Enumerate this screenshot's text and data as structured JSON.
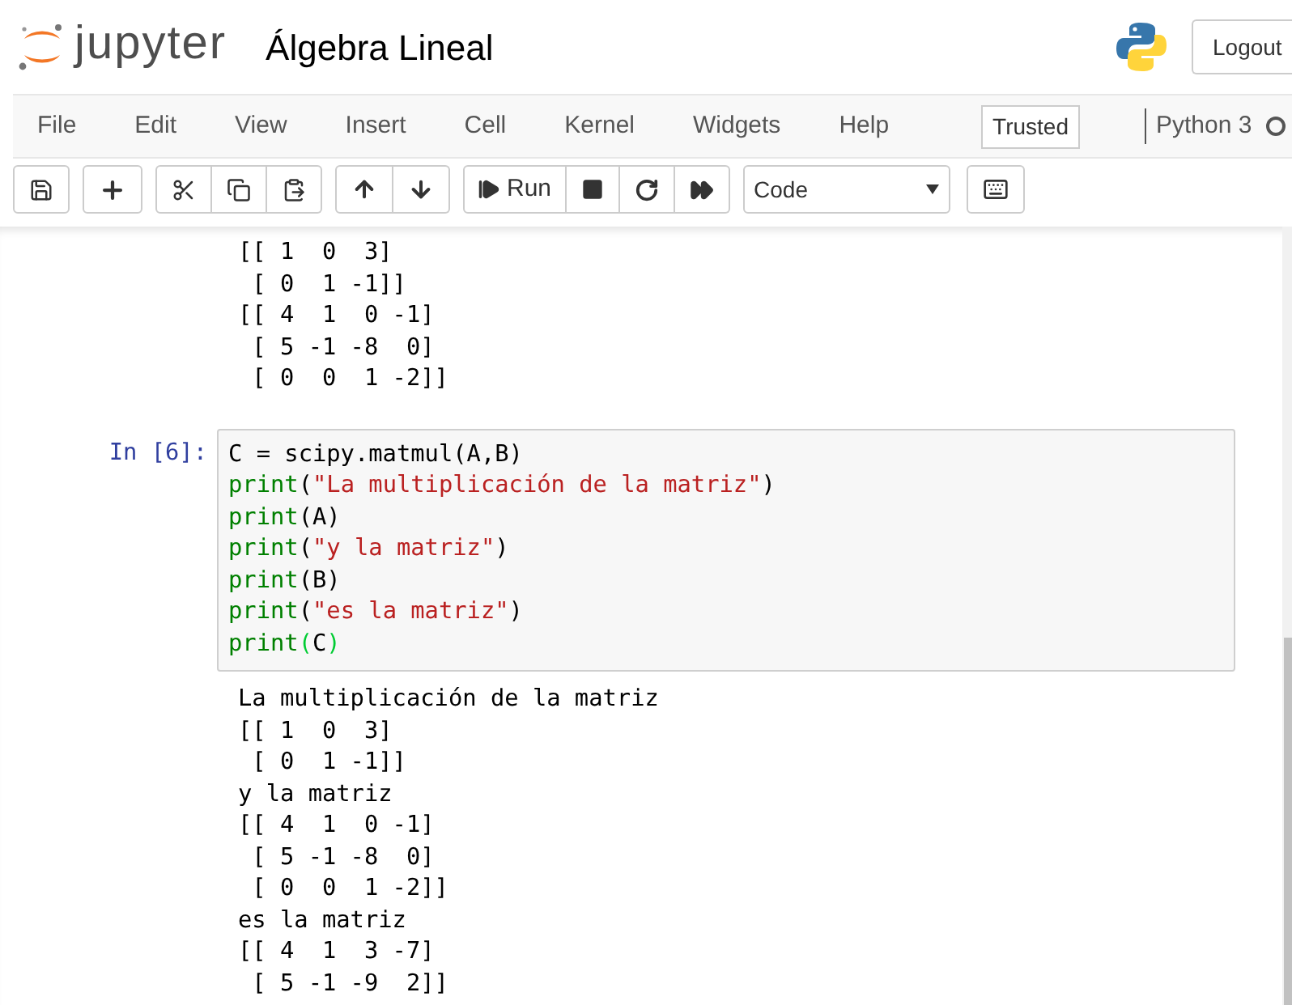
{
  "header": {
    "logo_text": "jupyter",
    "title": "Álgebra Lineal",
    "logout": "Logout"
  },
  "menu": [
    "File",
    "Edit",
    "View",
    "Insert",
    "Cell",
    "Kernel",
    "Widgets",
    "Help"
  ],
  "trusted": "Trusted",
  "kernel": "Python 3",
  "toolbar": {
    "run": "Run",
    "cell_type": "Code"
  },
  "cells": [
    {
      "kind": "output",
      "lines": [
        "[[ 1  0  3]",
        " [ 0  1 -1]]",
        "[[ 4  1  0 -1]",
        " [ 5 -1 -8  0]",
        " [ 0  0  1 -2]]"
      ]
    },
    {
      "kind": "code",
      "prompt": "In [6]:",
      "lines": [
        [
          {
            "kind": "plain",
            "text": "C = scipy.matmul(A,B)"
          }
        ],
        [
          {
            "kind": "builtin",
            "text": "print"
          },
          {
            "kind": "plain",
            "text": "("
          },
          {
            "kind": "string",
            "text": "\"La multiplicación de la matriz\""
          },
          {
            "kind": "plain",
            "text": ")"
          }
        ],
        [
          {
            "kind": "builtin",
            "text": "print"
          },
          {
            "kind": "plain",
            "text": "(A)"
          }
        ],
        [
          {
            "kind": "builtin",
            "text": "print"
          },
          {
            "kind": "plain",
            "text": "("
          },
          {
            "kind": "string",
            "text": "\"y la matriz\""
          },
          {
            "kind": "plain",
            "text": ")"
          }
        ],
        [
          {
            "kind": "builtin",
            "text": "print"
          },
          {
            "kind": "plain",
            "text": "(B)"
          }
        ],
        [
          {
            "kind": "builtin",
            "text": "print"
          },
          {
            "kind": "plain",
            "text": "("
          },
          {
            "kind": "string",
            "text": "\"es la matriz\""
          },
          {
            "kind": "plain",
            "text": ")"
          }
        ],
        [
          {
            "kind": "builtin",
            "text": "print"
          },
          {
            "kind": "match",
            "text": "("
          },
          {
            "kind": "plain",
            "text": "C"
          },
          {
            "kind": "match",
            "text": ")"
          }
        ]
      ]
    },
    {
      "kind": "output",
      "lines": [
        "La multiplicación de la matriz",
        "[[ 1  0  3]",
        " [ 0  1 -1]]",
        "y la matriz",
        "[[ 4  1  0 -1]",
        " [ 5 -1 -8  0]",
        " [ 0  0  1 -2]]",
        "es la matriz",
        "[[ 4  1  3 -7]",
        " [ 5 -1 -9  2]]"
      ]
    }
  ]
}
